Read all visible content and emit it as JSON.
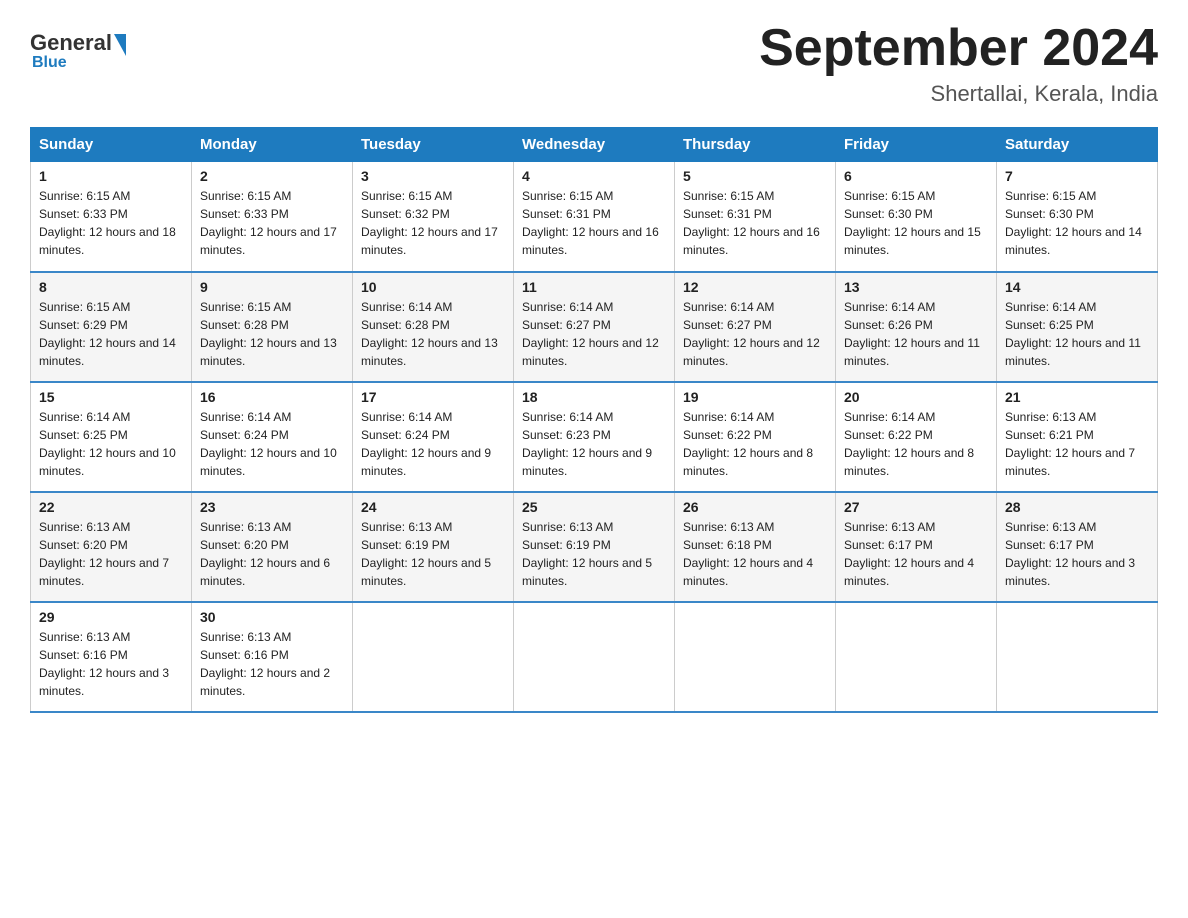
{
  "header": {
    "logo_general": "General",
    "logo_blue": "Blue",
    "month_title": "September 2024",
    "location": "Shertallai, Kerala, India"
  },
  "weekdays": [
    "Sunday",
    "Monday",
    "Tuesday",
    "Wednesday",
    "Thursday",
    "Friday",
    "Saturday"
  ],
  "weeks": [
    [
      {
        "day": "1",
        "sunrise": "Sunrise: 6:15 AM",
        "sunset": "Sunset: 6:33 PM",
        "daylight": "Daylight: 12 hours and 18 minutes."
      },
      {
        "day": "2",
        "sunrise": "Sunrise: 6:15 AM",
        "sunset": "Sunset: 6:33 PM",
        "daylight": "Daylight: 12 hours and 17 minutes."
      },
      {
        "day": "3",
        "sunrise": "Sunrise: 6:15 AM",
        "sunset": "Sunset: 6:32 PM",
        "daylight": "Daylight: 12 hours and 17 minutes."
      },
      {
        "day": "4",
        "sunrise": "Sunrise: 6:15 AM",
        "sunset": "Sunset: 6:31 PM",
        "daylight": "Daylight: 12 hours and 16 minutes."
      },
      {
        "day": "5",
        "sunrise": "Sunrise: 6:15 AM",
        "sunset": "Sunset: 6:31 PM",
        "daylight": "Daylight: 12 hours and 16 minutes."
      },
      {
        "day": "6",
        "sunrise": "Sunrise: 6:15 AM",
        "sunset": "Sunset: 6:30 PM",
        "daylight": "Daylight: 12 hours and 15 minutes."
      },
      {
        "day": "7",
        "sunrise": "Sunrise: 6:15 AM",
        "sunset": "Sunset: 6:30 PM",
        "daylight": "Daylight: 12 hours and 14 minutes."
      }
    ],
    [
      {
        "day": "8",
        "sunrise": "Sunrise: 6:15 AM",
        "sunset": "Sunset: 6:29 PM",
        "daylight": "Daylight: 12 hours and 14 minutes."
      },
      {
        "day": "9",
        "sunrise": "Sunrise: 6:15 AM",
        "sunset": "Sunset: 6:28 PM",
        "daylight": "Daylight: 12 hours and 13 minutes."
      },
      {
        "day": "10",
        "sunrise": "Sunrise: 6:14 AM",
        "sunset": "Sunset: 6:28 PM",
        "daylight": "Daylight: 12 hours and 13 minutes."
      },
      {
        "day": "11",
        "sunrise": "Sunrise: 6:14 AM",
        "sunset": "Sunset: 6:27 PM",
        "daylight": "Daylight: 12 hours and 12 minutes."
      },
      {
        "day": "12",
        "sunrise": "Sunrise: 6:14 AM",
        "sunset": "Sunset: 6:27 PM",
        "daylight": "Daylight: 12 hours and 12 minutes."
      },
      {
        "day": "13",
        "sunrise": "Sunrise: 6:14 AM",
        "sunset": "Sunset: 6:26 PM",
        "daylight": "Daylight: 12 hours and 11 minutes."
      },
      {
        "day": "14",
        "sunrise": "Sunrise: 6:14 AM",
        "sunset": "Sunset: 6:25 PM",
        "daylight": "Daylight: 12 hours and 11 minutes."
      }
    ],
    [
      {
        "day": "15",
        "sunrise": "Sunrise: 6:14 AM",
        "sunset": "Sunset: 6:25 PM",
        "daylight": "Daylight: 12 hours and 10 minutes."
      },
      {
        "day": "16",
        "sunrise": "Sunrise: 6:14 AM",
        "sunset": "Sunset: 6:24 PM",
        "daylight": "Daylight: 12 hours and 10 minutes."
      },
      {
        "day": "17",
        "sunrise": "Sunrise: 6:14 AM",
        "sunset": "Sunset: 6:24 PM",
        "daylight": "Daylight: 12 hours and 9 minutes."
      },
      {
        "day": "18",
        "sunrise": "Sunrise: 6:14 AM",
        "sunset": "Sunset: 6:23 PM",
        "daylight": "Daylight: 12 hours and 9 minutes."
      },
      {
        "day": "19",
        "sunrise": "Sunrise: 6:14 AM",
        "sunset": "Sunset: 6:22 PM",
        "daylight": "Daylight: 12 hours and 8 minutes."
      },
      {
        "day": "20",
        "sunrise": "Sunrise: 6:14 AM",
        "sunset": "Sunset: 6:22 PM",
        "daylight": "Daylight: 12 hours and 8 minutes."
      },
      {
        "day": "21",
        "sunrise": "Sunrise: 6:13 AM",
        "sunset": "Sunset: 6:21 PM",
        "daylight": "Daylight: 12 hours and 7 minutes."
      }
    ],
    [
      {
        "day": "22",
        "sunrise": "Sunrise: 6:13 AM",
        "sunset": "Sunset: 6:20 PM",
        "daylight": "Daylight: 12 hours and 7 minutes."
      },
      {
        "day": "23",
        "sunrise": "Sunrise: 6:13 AM",
        "sunset": "Sunset: 6:20 PM",
        "daylight": "Daylight: 12 hours and 6 minutes."
      },
      {
        "day": "24",
        "sunrise": "Sunrise: 6:13 AM",
        "sunset": "Sunset: 6:19 PM",
        "daylight": "Daylight: 12 hours and 5 minutes."
      },
      {
        "day": "25",
        "sunrise": "Sunrise: 6:13 AM",
        "sunset": "Sunset: 6:19 PM",
        "daylight": "Daylight: 12 hours and 5 minutes."
      },
      {
        "day": "26",
        "sunrise": "Sunrise: 6:13 AM",
        "sunset": "Sunset: 6:18 PM",
        "daylight": "Daylight: 12 hours and 4 minutes."
      },
      {
        "day": "27",
        "sunrise": "Sunrise: 6:13 AM",
        "sunset": "Sunset: 6:17 PM",
        "daylight": "Daylight: 12 hours and 4 minutes."
      },
      {
        "day": "28",
        "sunrise": "Sunrise: 6:13 AM",
        "sunset": "Sunset: 6:17 PM",
        "daylight": "Daylight: 12 hours and 3 minutes."
      }
    ],
    [
      {
        "day": "29",
        "sunrise": "Sunrise: 6:13 AM",
        "sunset": "Sunset: 6:16 PM",
        "daylight": "Daylight: 12 hours and 3 minutes."
      },
      {
        "day": "30",
        "sunrise": "Sunrise: 6:13 AM",
        "sunset": "Sunset: 6:16 PM",
        "daylight": "Daylight: 12 hours and 2 minutes."
      },
      null,
      null,
      null,
      null,
      null
    ]
  ]
}
